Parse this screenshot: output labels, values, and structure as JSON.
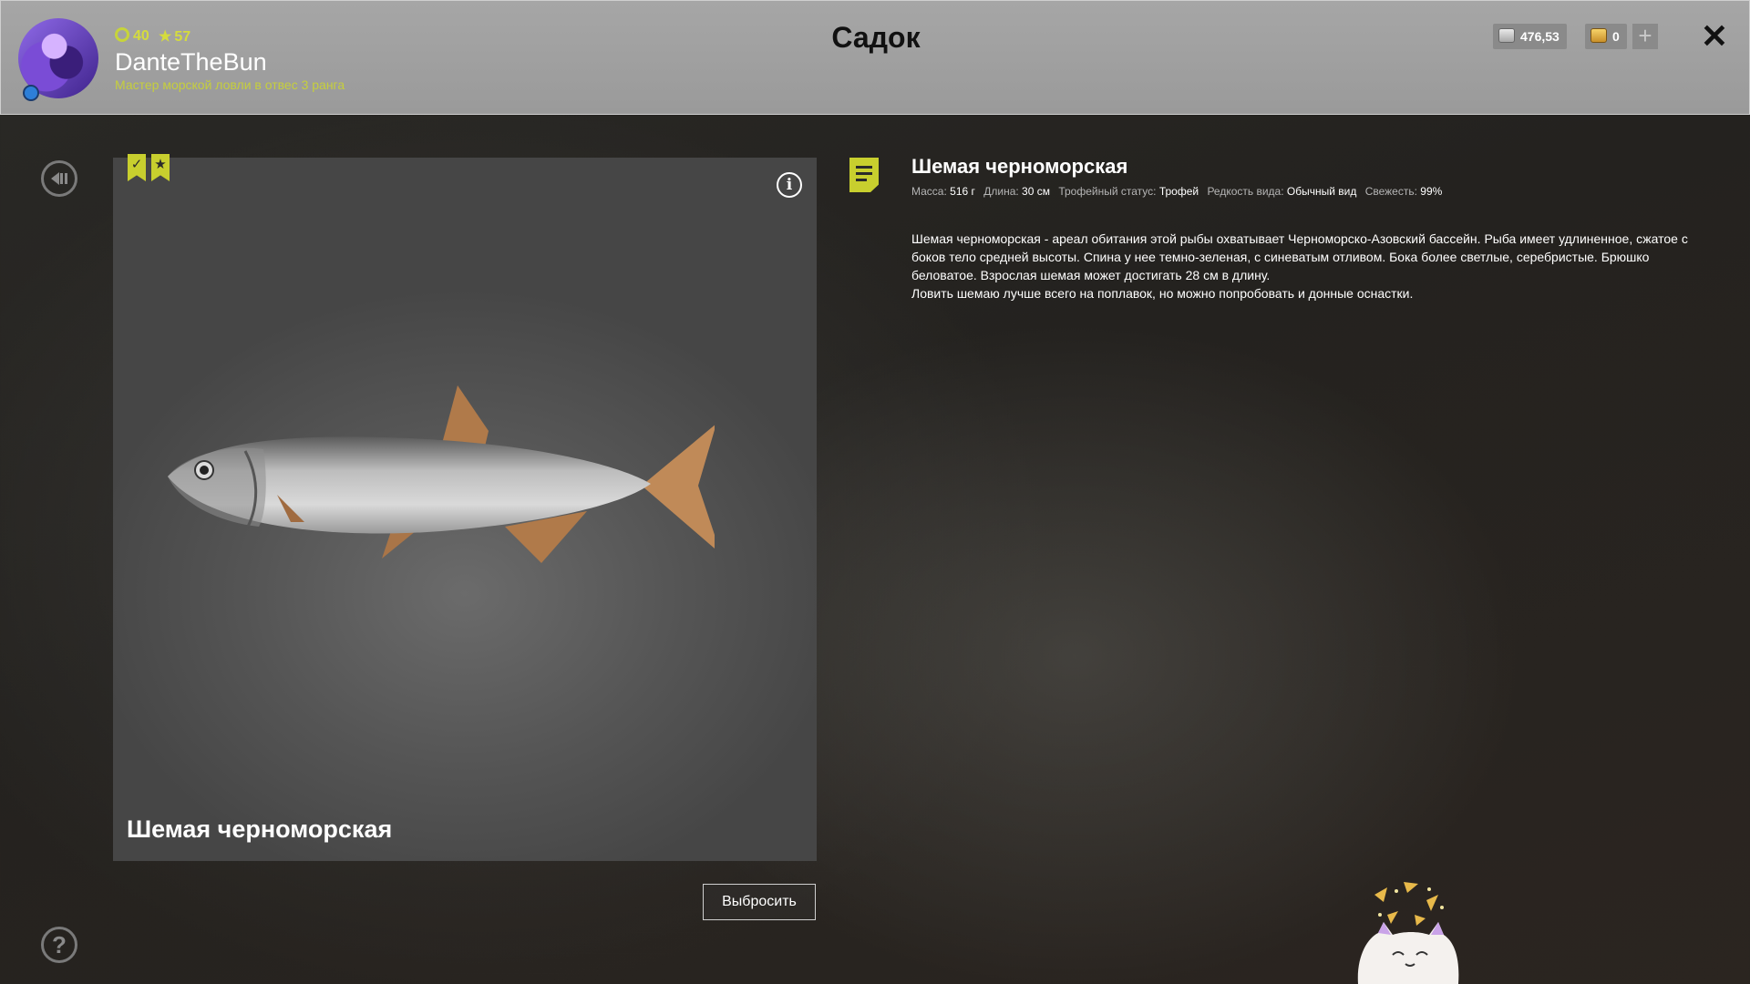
{
  "header": {
    "title": "Садок",
    "player": {
      "level": "40",
      "stars": "57",
      "username": "DanteTheBun",
      "rank": "Мастер морской ловли в отвес 3 ранга"
    },
    "currency": {
      "silver": "476,53",
      "gold": "0",
      "add_label": "+"
    },
    "close_label": "✕"
  },
  "panel": {
    "fish_name": "Шемая черноморская",
    "info_label": "i",
    "discard_label": "Выбросить"
  },
  "details": {
    "fish_name": "Шемая черноморская",
    "props": [
      {
        "label": "Масса:",
        "value": "516 г"
      },
      {
        "label": "Длина:",
        "value": "30 см"
      },
      {
        "label": "Трофейный статус:",
        "value": "Трофей"
      },
      {
        "label": "Редкость вида:",
        "value": "Обычный вид"
      },
      {
        "label": "Свежесть:",
        "value": "99%"
      }
    ],
    "description": [
      "Шемая черноморская - ареал обитания этой рыбы охватывает Черноморско-Азовский бассейн. Рыба имеет удлиненное, сжатое с боков тело средней высоты. Спина у нее темно-зеленая, с синеватым отливом. Бока более светлые, серебристые. Брюшко беловатое. Взрослая шемая может достигать 28 см в длину.",
      "Ловить шемаю лучше всего на поплавок, но можно попробовать и донные оснастки."
    ]
  },
  "controls": {
    "help_label": "?"
  },
  "colors": {
    "accent": "#c8cf2e",
    "header_bg": "#a6a6a6"
  }
}
